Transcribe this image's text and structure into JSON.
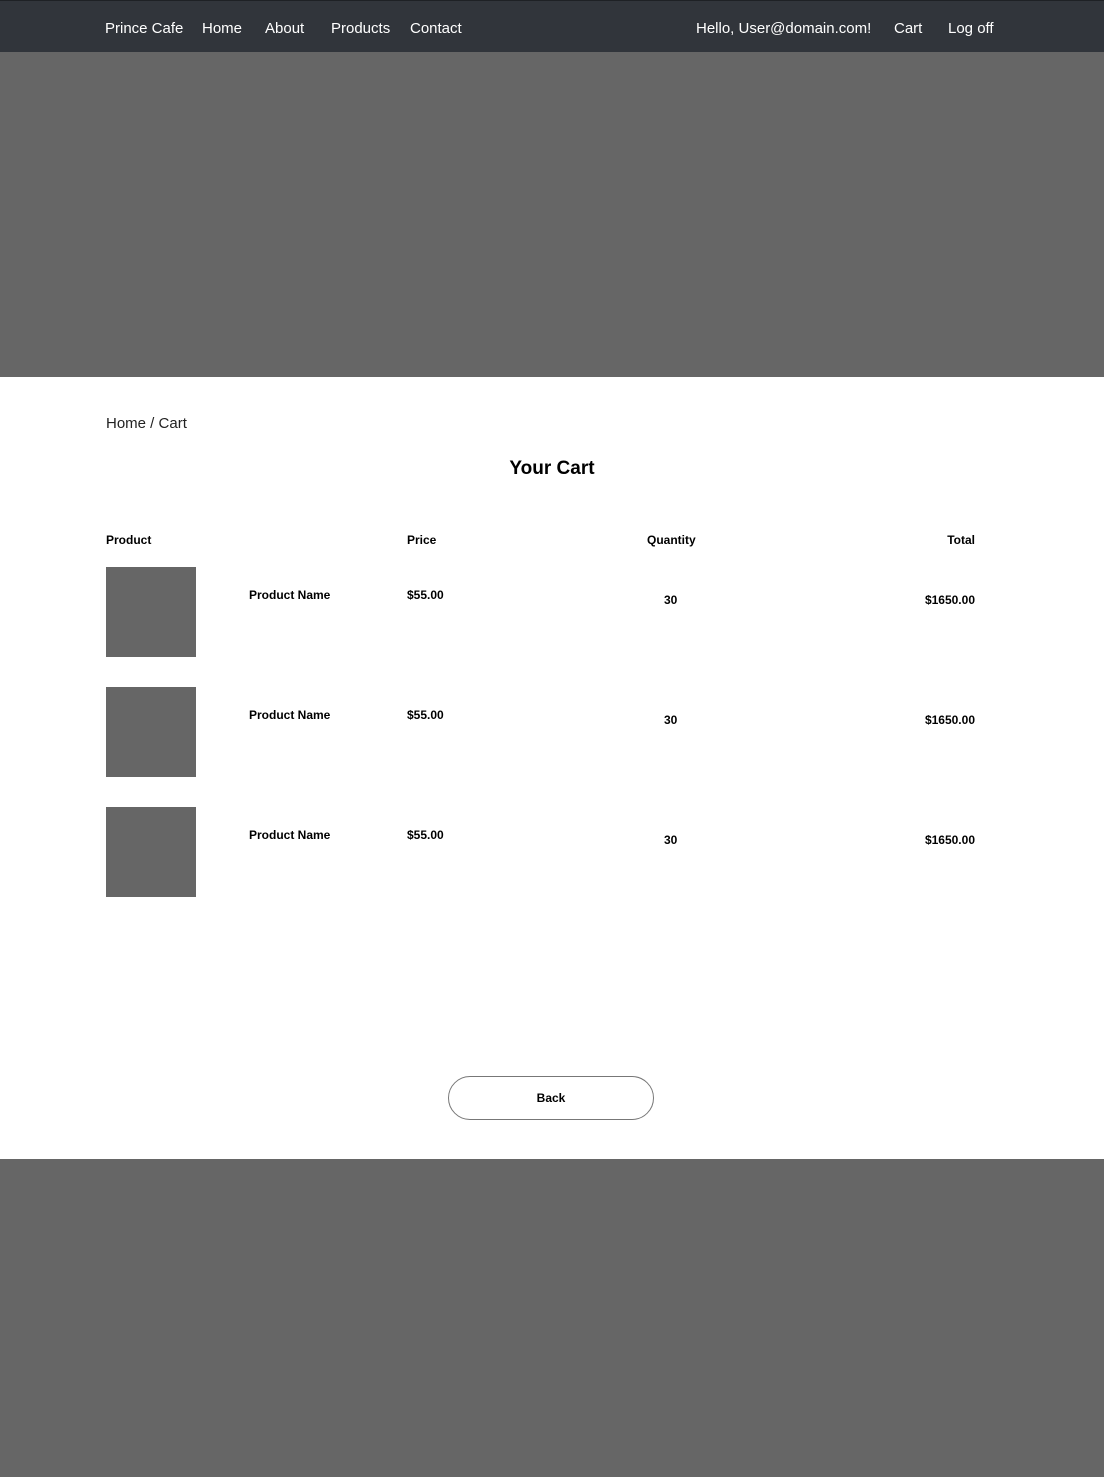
{
  "nav": {
    "brand": "Prince Cafe",
    "links": [
      "Home",
      "About",
      "Products",
      "Contact"
    ],
    "greeting": "Hello, User@domain.com!",
    "cart": "Cart",
    "logoff": "Log off"
  },
  "breadcrumb": {
    "home": "Home",
    "separator": " / ",
    "current": "Cart"
  },
  "page_title": "Your Cart",
  "table": {
    "headers": {
      "product": "Product",
      "price": "Price",
      "quantity": "Quantity",
      "total": "Total"
    },
    "rows": [
      {
        "name": "Product Name",
        "price": "$55.00",
        "quantity": "30",
        "total": "$1650.00"
      },
      {
        "name": "Product Name",
        "price": "$55.00",
        "quantity": "30",
        "total": "$1650.00"
      },
      {
        "name": "Product Name",
        "price": "$55.00",
        "quantity": "30",
        "total": "$1650.00"
      }
    ]
  },
  "back_button": "Back",
  "colors": {
    "navbar": "#31353b",
    "placeholder": "#666666",
    "background": "#ffffff"
  }
}
